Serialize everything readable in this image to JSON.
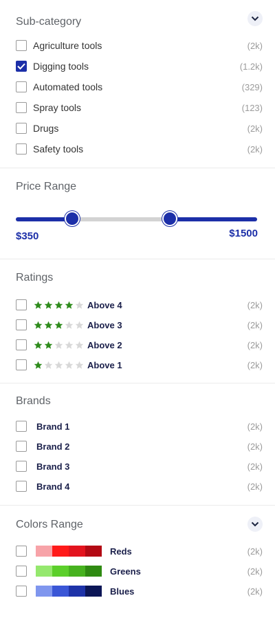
{
  "accent": "#1c2fa8",
  "star_color": "#2e8b1c",
  "subcategory": {
    "title": "Sub-category",
    "items": [
      {
        "label": "Agriculture tools",
        "count": "(2k)",
        "checked": false
      },
      {
        "label": "Digging tools",
        "count": "(1.2k)",
        "checked": true
      },
      {
        "label": "Automated tools",
        "count": "(329)",
        "checked": false
      },
      {
        "label": "Spray tools",
        "count": "(123)",
        "checked": false
      },
      {
        "label": "Drugs",
        "count": "(2k)",
        "checked": false
      },
      {
        "label": "Safety tools",
        "count": "(2k)",
        "checked": false
      }
    ]
  },
  "price": {
    "title": "Price Range",
    "min_label": "$350",
    "max_label": "$1500",
    "range_fraction": [
      0.23,
      0.64
    ]
  },
  "ratings": {
    "title": "Ratings",
    "items": [
      {
        "label": "Above 4",
        "count": "(2k)",
        "stars": 4
      },
      {
        "label": "Above 3",
        "count": "(2k)",
        "stars": 3
      },
      {
        "label": "Above 2",
        "count": "(2k)",
        "stars": 2
      },
      {
        "label": "Above 1",
        "count": "(2k)",
        "stars": 1
      }
    ]
  },
  "brands": {
    "title": "Brands",
    "items": [
      {
        "label": "Brand 1",
        "count": "(2k)"
      },
      {
        "label": "Brand 2",
        "count": "(2k)"
      },
      {
        "label": "Brand 3",
        "count": "(2k)"
      },
      {
        "label": "Brand 4",
        "count": "(2k)"
      }
    ]
  },
  "colors": {
    "title": "Colors Range",
    "items": [
      {
        "label": "Reds",
        "count": "(2k)",
        "swatches": [
          "#f7a3a8",
          "#ff1a1a",
          "#e3141e",
          "#b30a14"
        ]
      },
      {
        "label": "Greens",
        "count": "(2k)",
        "swatches": [
          "#95e86e",
          "#5ccf2b",
          "#47b21f",
          "#2f8a12"
        ]
      },
      {
        "label": "Blues",
        "count": "(2k)",
        "swatches": [
          "#7f96ee",
          "#3a56d6",
          "#1e33a8",
          "#0c1656"
        ]
      }
    ]
  }
}
